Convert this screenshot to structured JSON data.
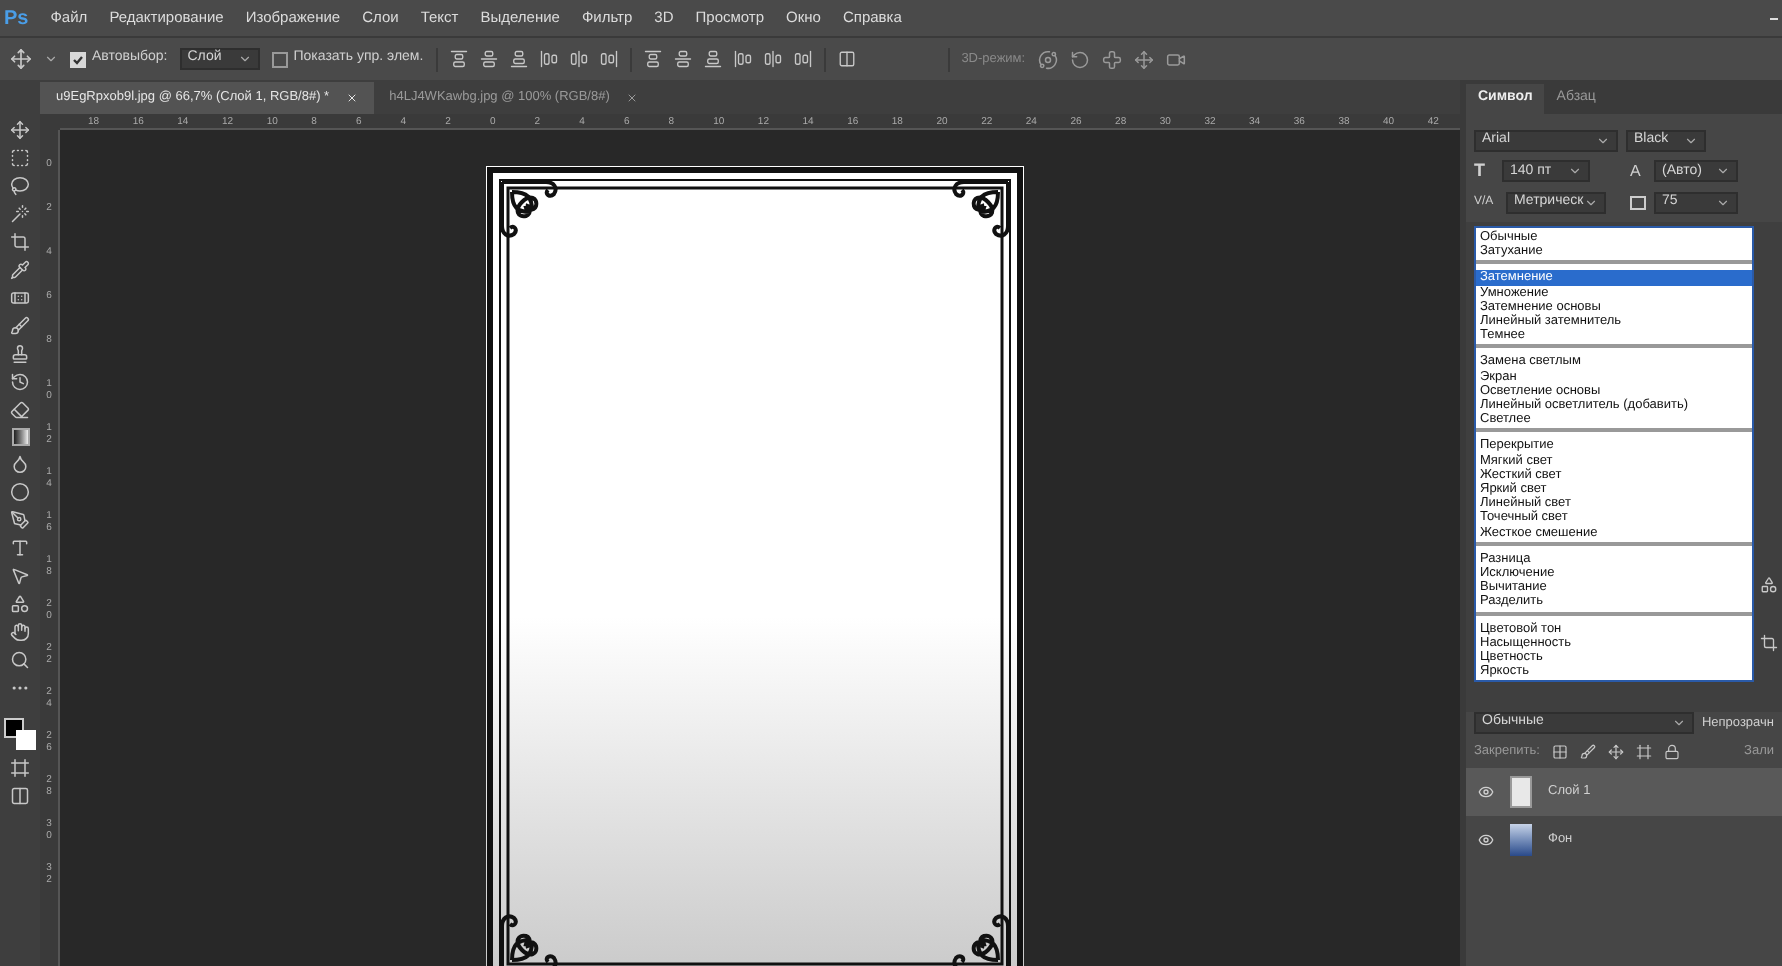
{
  "menu": {
    "logo": "Ps",
    "items": [
      "Файл",
      "Редактирование",
      "Изображение",
      "Слои",
      "Текст",
      "Выделение",
      "Фильтр",
      "3D",
      "Просмотр",
      "Окно",
      "Справка"
    ]
  },
  "options": {
    "autoselect": {
      "label": "Автовыбор:",
      "checked": true
    },
    "target": "Слой",
    "show_controls": {
      "label": "Показать упр. элем.",
      "checked": false
    },
    "mode_3d": "3D-режим:"
  },
  "tabs": [
    {
      "label": "u9EgRpxob9l.jpg @ 66,7% (Слой 1, RGB/8#) *",
      "selected": true
    },
    {
      "label": "h4LJ4WKawbg.jpg @ 100% (RGB/8#)",
      "selected": false
    }
  ],
  "ruler_h": [
    "18",
    "16",
    "14",
    "12",
    "10",
    "8",
    "6",
    "4",
    "2",
    "0",
    "2",
    "4",
    "6",
    "8",
    "10",
    "12",
    "14",
    "16",
    "18",
    "20",
    "22",
    "24",
    "26",
    "28",
    "30",
    "32",
    "34",
    "36",
    "38",
    "40",
    "42"
  ],
  "ruler_v": [
    "0",
    "2",
    "4",
    "6",
    "8",
    "10",
    "12",
    "14",
    "16",
    "18",
    "20",
    "22",
    "24",
    "26",
    "28",
    "30",
    "32"
  ],
  "panel": {
    "tabs": [
      {
        "label": "Символ",
        "selected": true
      },
      {
        "label": "Абзац",
        "selected": false
      }
    ],
    "size_symbol": "T",
    "leading_symbol": "A",
    "kerning_symbol": "V/A",
    "font": "Arial",
    "style": "Black",
    "size": "140 пт",
    "leading": "(Авто)",
    "kerning": "Метрическ",
    "tracking": "75"
  },
  "blend_list": [
    [
      {
        "label": "Обычные",
        "selected": false
      },
      {
        "label": "Затухание",
        "selected": false
      }
    ],
    [
      {
        "label": "Затемнение",
        "selected": true
      },
      {
        "label": "Умножение",
        "selected": false
      },
      {
        "label": "Затемнение основы",
        "selected": false
      },
      {
        "label": "Линейный затемнитель",
        "selected": false
      },
      {
        "label": "Темнее",
        "selected": false
      }
    ],
    [
      {
        "label": "Замена светлым",
        "selected": false
      },
      {
        "label": "Экран",
        "selected": false
      },
      {
        "label": "Осветление основы",
        "selected": false
      },
      {
        "label": "Линейный осветлитель (добавить)",
        "selected": false
      },
      {
        "label": "Светлее",
        "selected": false
      }
    ],
    [
      {
        "label": "Перекрытие",
        "selected": false
      },
      {
        "label": "Мягкий свет",
        "selected": false
      },
      {
        "label": "Жесткий свет",
        "selected": false
      },
      {
        "label": "Яркий свет",
        "selected": false
      },
      {
        "label": "Линейный свет",
        "selected": false
      },
      {
        "label": "Точечный свет",
        "selected": false
      },
      {
        "label": "Жесткое смешение",
        "selected": false
      }
    ],
    [
      {
        "label": "Разница",
        "selected": false
      },
      {
        "label": "Исключение",
        "selected": false
      },
      {
        "label": "Вычитание",
        "selected": false
      },
      {
        "label": "Разделить",
        "selected": false
      }
    ],
    [
      {
        "label": "Цветовой тон",
        "selected": false
      },
      {
        "label": "Насыщенность",
        "selected": false
      },
      {
        "label": "Цветность",
        "selected": false
      },
      {
        "label": "Яркость",
        "selected": false
      }
    ]
  ],
  "layers": {
    "blend_mode": "Обычные",
    "opacity_label": "Непрозрачн",
    "lock_label": "Закрепить:",
    "fill_label": "Зали",
    "items": [
      {
        "name": "Слой 1",
        "selected": true,
        "visible": true,
        "kind": "blank"
      },
      {
        "name": "Фон",
        "selected": false,
        "visible": true,
        "kind": "photo"
      }
    ]
  }
}
